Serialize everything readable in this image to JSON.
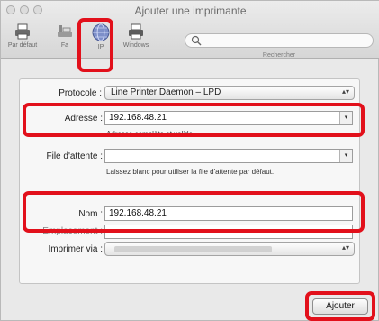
{
  "window": {
    "title": "Ajouter une imprimante"
  },
  "toolbar": {
    "items": [
      {
        "label": "Par défaut",
        "icon": "printer-default-icon"
      },
      {
        "label": "Fa",
        "icon": "fax-icon"
      },
      {
        "label": "IP",
        "icon": "ip-globe-icon"
      },
      {
        "label": "Windows",
        "icon": "windows-printer-icon"
      }
    ],
    "search_label": "Rechercher",
    "search_icon": "search-icon"
  },
  "form": {
    "protocol": {
      "label": "Protocole :",
      "value": "Line Printer Daemon – LPD"
    },
    "address": {
      "label": "Adresse :",
      "value": "192.168.48.21",
      "hint": "Adresse complète et valide"
    },
    "queue": {
      "label": "File d'attente :",
      "value": "",
      "hint": "Laissez blanc pour utiliser la file d'attente par défaut."
    },
    "name": {
      "label": "Nom :",
      "value": "192.168.48.21"
    },
    "location": {
      "label": "Emplacement :",
      "value": ""
    },
    "print_via": {
      "label": "Imprimer via :",
      "value": ""
    }
  },
  "actions": {
    "add_label": "Ajouter"
  },
  "colors": {
    "highlight": "#e2101b"
  }
}
